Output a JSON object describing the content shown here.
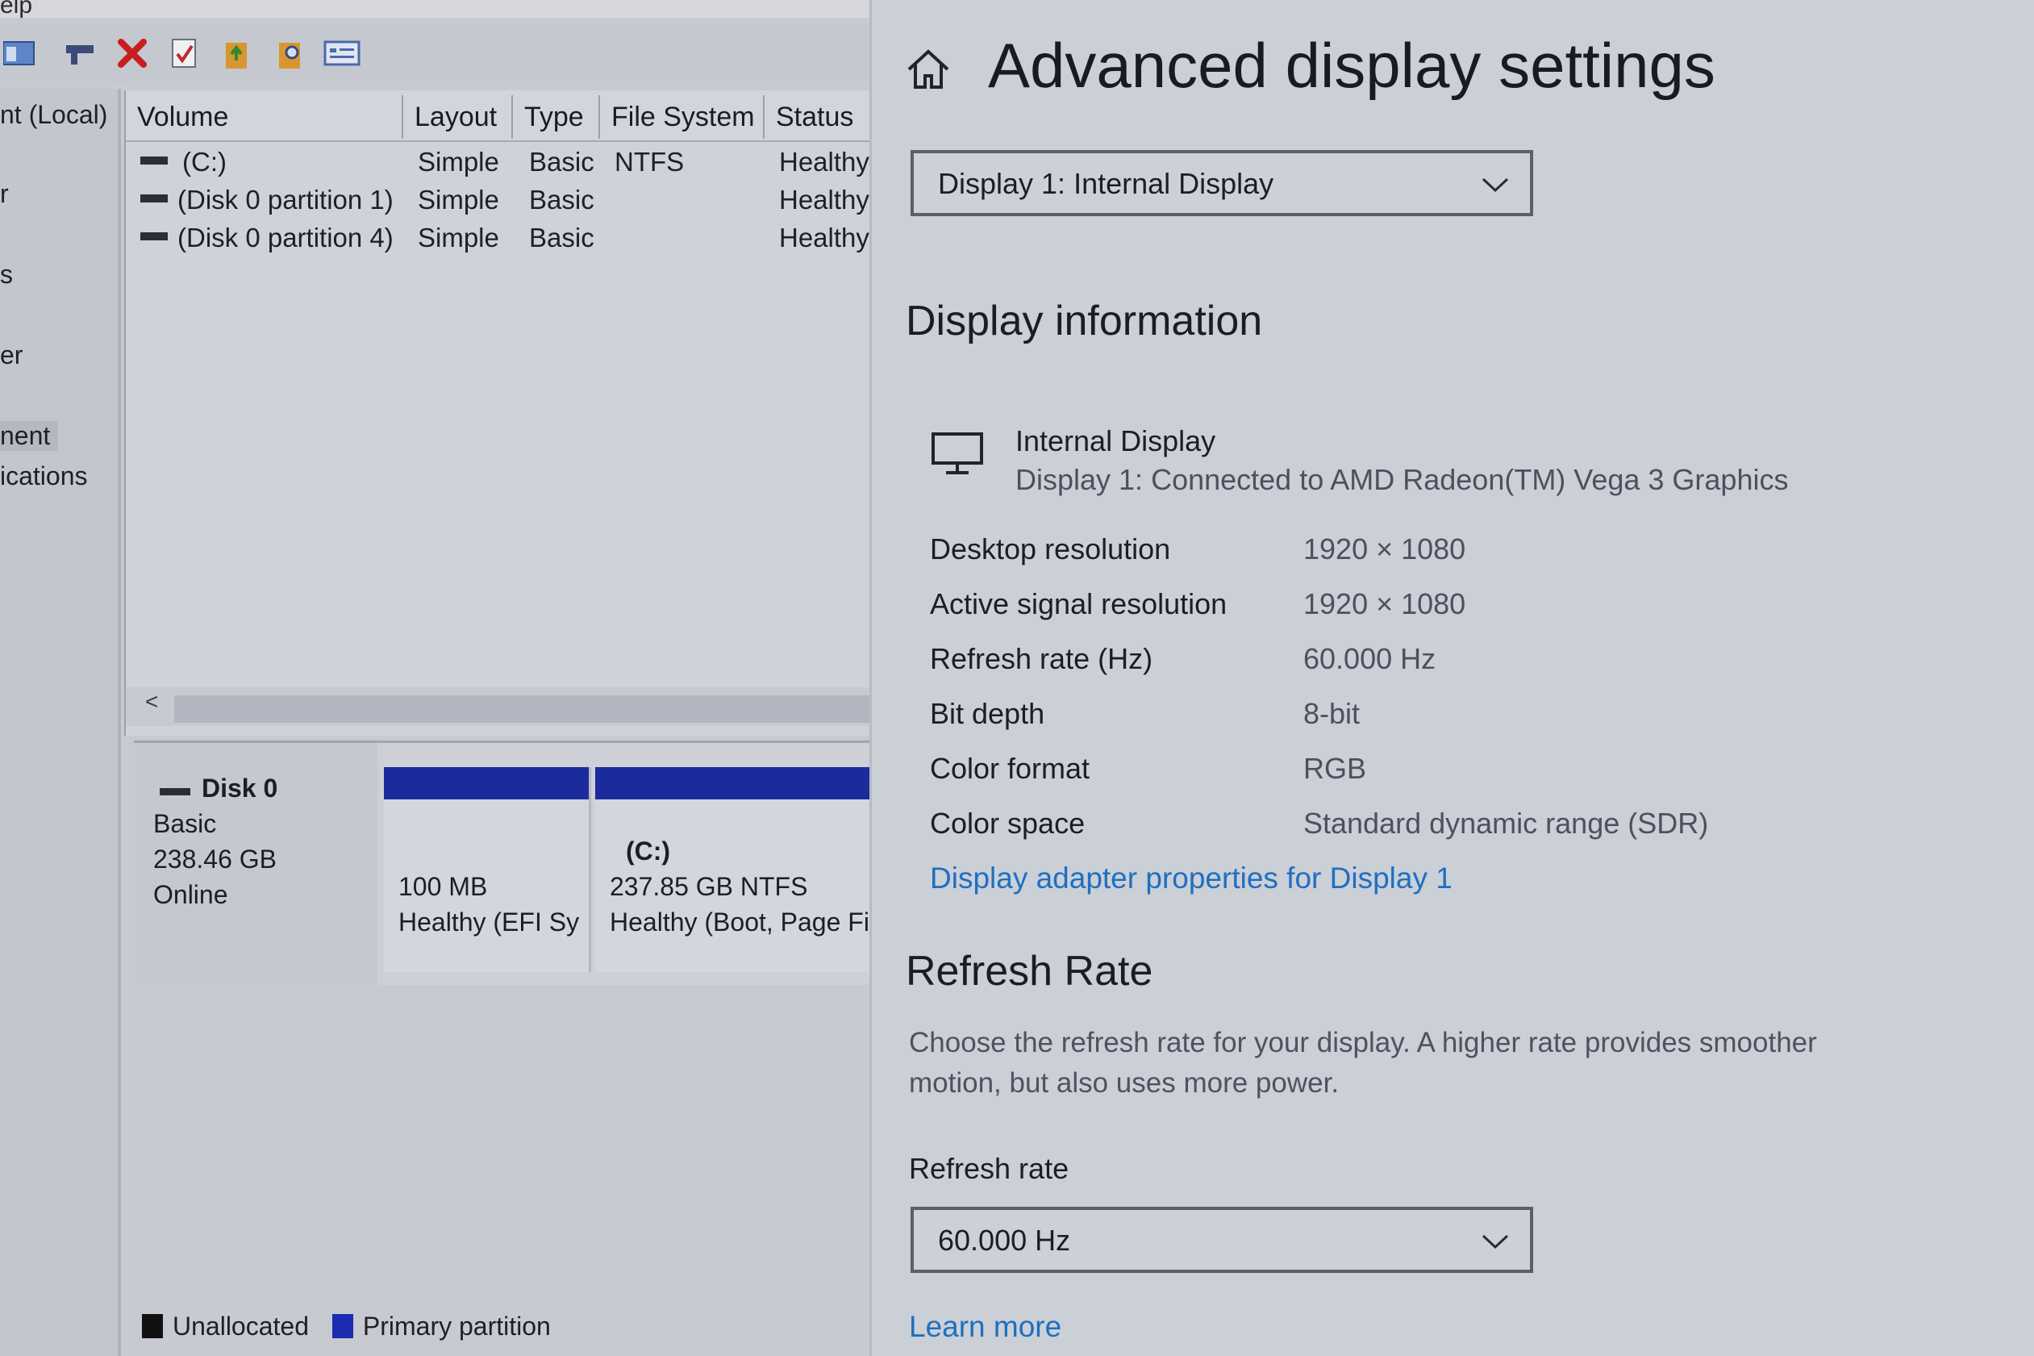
{
  "disk_management": {
    "menu_fragment": "elp",
    "nav_items": [
      "nt (Local)",
      "r",
      "s",
      "er",
      "nent",
      "ications"
    ],
    "toolbar_icons": [
      "console-tree-icon",
      "connect-icon",
      "delete-icon",
      "properties-icon",
      "up-folder-icon",
      "search-folder-icon",
      "help-view-icon"
    ],
    "columns": [
      "Volume",
      "Layout",
      "Type",
      "File System",
      "Status"
    ],
    "volumes": [
      {
        "volume": "(C:)",
        "layout": "Simple",
        "type": "Basic",
        "fs": "NTFS",
        "status": "Healthy"
      },
      {
        "volume": "(Disk 0 partition 1)",
        "layout": "Simple",
        "type": "Basic",
        "fs": "",
        "status": "Healthy"
      },
      {
        "volume": "(Disk 0 partition 4)",
        "layout": "Simple",
        "type": "Basic",
        "fs": "",
        "status": "Healthy"
      }
    ],
    "scroll_arrow": "<",
    "disk": {
      "name": "Disk 0",
      "type": "Basic",
      "size": "238.46 GB",
      "state": "Online",
      "partitions": [
        {
          "label": "",
          "size": "100 MB",
          "status": "Healthy (EFI Sy"
        },
        {
          "label": "(C:)",
          "size": "237.85 GB NTFS",
          "status": "Healthy (Boot, Page Fi"
        }
      ]
    },
    "legend": [
      {
        "label": "Unallocated",
        "color": "#111111"
      },
      {
        "label": "Primary partition",
        "color": "#1c2bb0"
      }
    ]
  },
  "settings": {
    "title": "Advanced display settings",
    "display_select": "Display 1: Internal Display",
    "display_info_heading": "Display information",
    "display_name": "Internal Display",
    "display_subtitle": "Display 1: Connected to AMD Radeon(TM) Vega 3 Graphics",
    "info_rows": [
      {
        "label": "Desktop resolution",
        "value": "1920 × 1080"
      },
      {
        "label": "Active signal resolution",
        "value": "1920 × 1080"
      },
      {
        "label": "Refresh rate (Hz)",
        "value": "60.000 Hz"
      },
      {
        "label": "Bit depth",
        "value": "8-bit"
      },
      {
        "label": "Color format",
        "value": "RGB"
      },
      {
        "label": "Color space",
        "value": "Standard dynamic range (SDR)"
      }
    ],
    "adapter_link": "Display adapter properties for Display 1",
    "refresh_heading": "Refresh Rate",
    "refresh_desc": "Choose the refresh rate for your display. A higher rate provides smoother motion, but also uses more power.",
    "refresh_label": "Refresh rate",
    "refresh_select": "60.000 Hz",
    "learn_more": "Learn more",
    "accent_color": "#1e6fc2"
  }
}
